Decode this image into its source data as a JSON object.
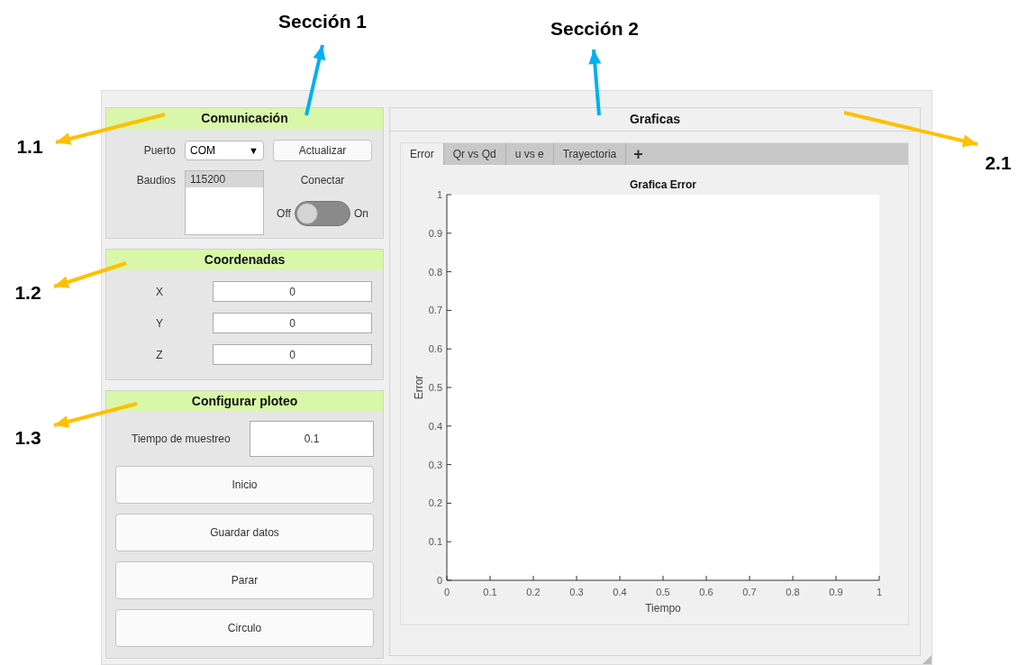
{
  "annotations": [
    {
      "label": "Sección 1",
      "color": "#00b0f0"
    },
    {
      "label": "Sección 2",
      "color": "#00b0f0"
    },
    {
      "label": "1.1",
      "color": "#ffc000"
    },
    {
      "label": "1.2",
      "color": "#ffc000"
    },
    {
      "label": "1.3",
      "color": "#ffc000"
    },
    {
      "label": "2.1",
      "color": "#ffc000"
    }
  ],
  "comunicacion": {
    "title": "Comunicación",
    "port_label": "Puerto",
    "port_value": "COM",
    "port_caret": "▼",
    "refresh_button": "Actualizar",
    "baud_label": "Baudios",
    "baud_items": [
      {
        "label": "115200",
        "selected": true
      }
    ],
    "connect_label": "Conectar",
    "switch": {
      "off_label": "Off",
      "on_label": "On",
      "on": false
    }
  },
  "coordenadas": {
    "title": "Coordenadas",
    "fields": [
      {
        "label": "X",
        "value": "0"
      },
      {
        "label": "Y",
        "value": "0"
      },
      {
        "label": "Z",
        "value": "0"
      }
    ]
  },
  "ploteo": {
    "title": "Configurar ploteo",
    "sample_label": "Tiempo de muestreo",
    "sample_value": "0.1",
    "buttons": [
      "Inicio",
      "Guardar datos",
      "Parar",
      "Circulo"
    ]
  },
  "graficas": {
    "title": "Graficas",
    "tabs": [
      {
        "label": "Error",
        "selected": true
      },
      {
        "label": "Qr vs Qd",
        "selected": false
      },
      {
        "label": "u vs e",
        "selected": false
      },
      {
        "label": "Trayectoria",
        "selected": false
      }
    ],
    "add_tab": "+",
    "chart_data": {
      "type": "line",
      "title": "Grafica Error",
      "xlabel": "Tiempo",
      "ylabel": "Error",
      "xlim": [
        0,
        1
      ],
      "ylim": [
        0,
        1
      ],
      "xticks": [
        0,
        0.1,
        0.2,
        0.3,
        0.4,
        0.5,
        0.6,
        0.7,
        0.8,
        0.9,
        1
      ],
      "yticks": [
        0,
        0.1,
        0.2,
        0.3,
        0.4,
        0.5,
        0.6,
        0.7,
        0.8,
        0.9,
        1
      ]
    }
  }
}
